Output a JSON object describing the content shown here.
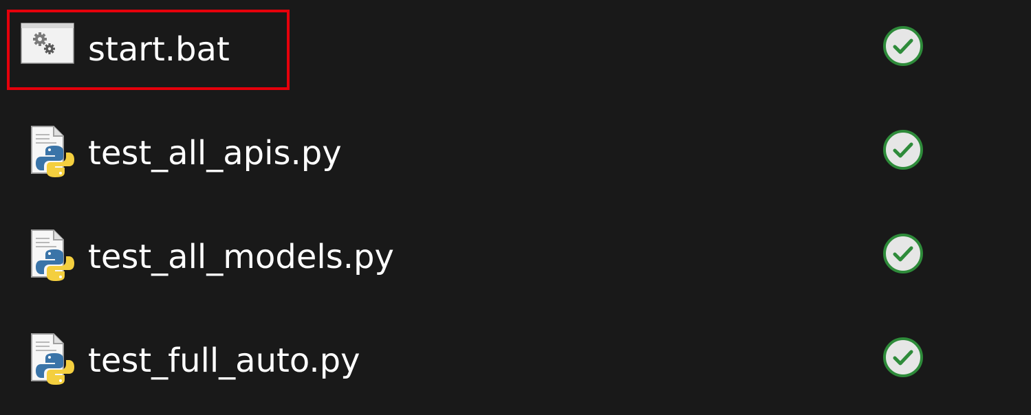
{
  "files": [
    {
      "name": "start.bat",
      "type": "batch",
      "icon": "batch-file-gears-icon",
      "status": "synced",
      "status_icon": "green-check-circle-icon",
      "highlighted": true
    },
    {
      "name": "test_all_apis.py",
      "type": "python",
      "icon": "python-file-icon",
      "status": "synced",
      "status_icon": "green-check-circle-icon",
      "highlighted": false
    },
    {
      "name": "test_all_models.py",
      "type": "python",
      "icon": "python-file-icon",
      "status": "synced",
      "status_icon": "green-check-circle-icon",
      "highlighted": false
    },
    {
      "name": "test_full_auto.py",
      "type": "python",
      "icon": "python-file-icon",
      "status": "synced",
      "status_icon": "green-check-circle-icon",
      "highlighted": false
    }
  ],
  "colors": {
    "background": "#191919",
    "text": "#ffffff",
    "highlight_border": "#e5000b",
    "status_green": "#2e8b3a",
    "python_blue": "#3a74a8",
    "python_yellow": "#f4cf3f"
  }
}
